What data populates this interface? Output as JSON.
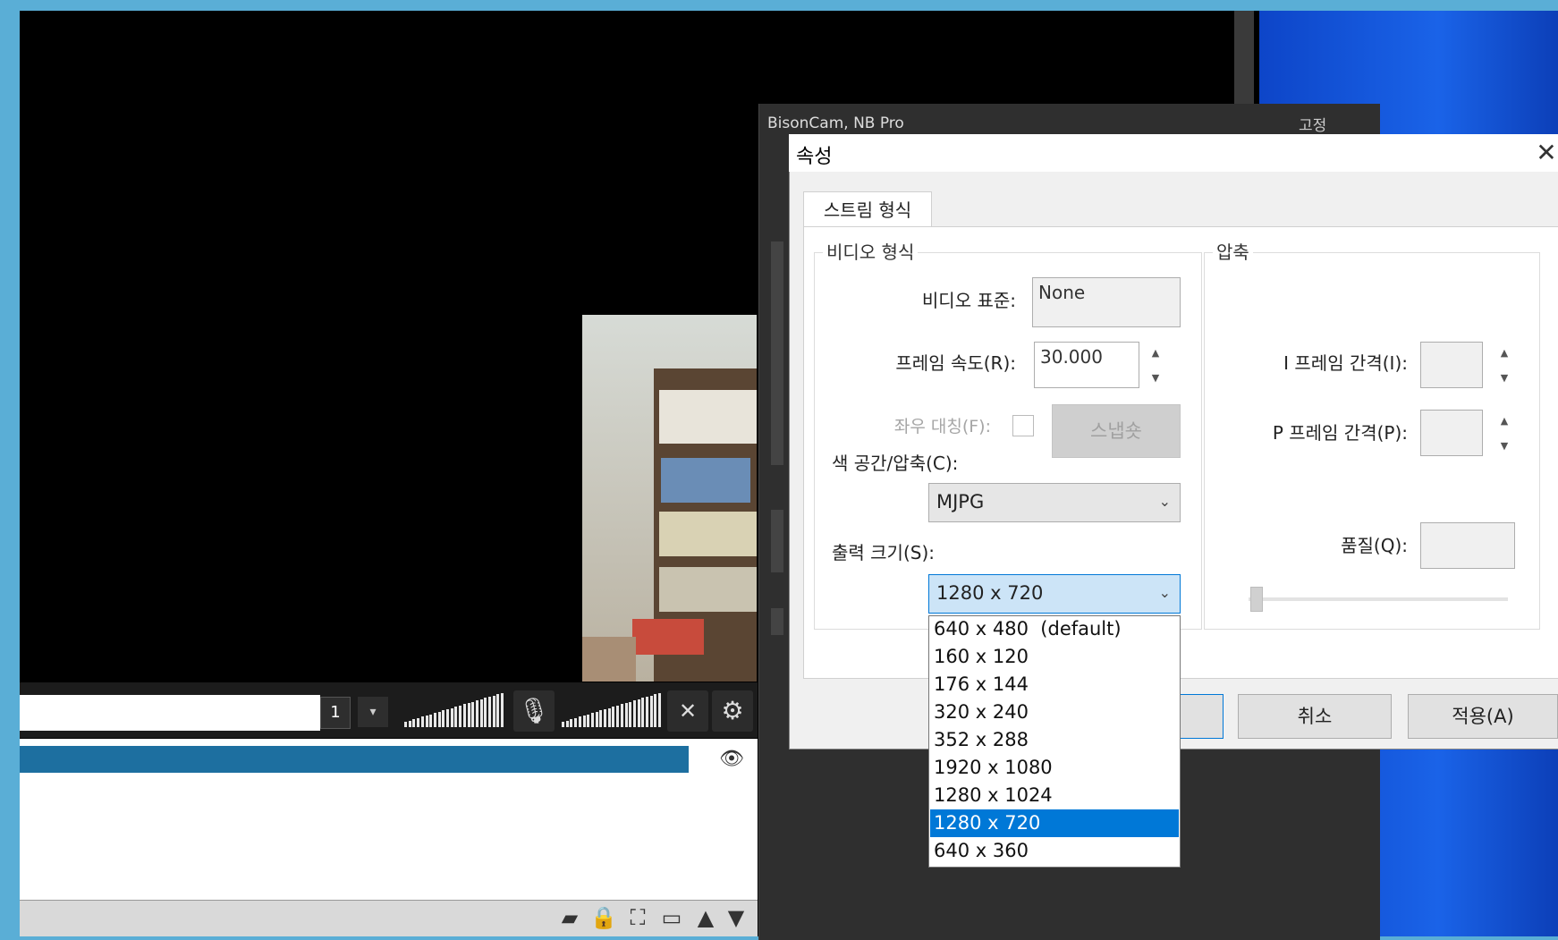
{
  "camera_window": {
    "title": "BisonCam, NB Pro",
    "controls": "고정"
  },
  "dialog": {
    "title": "속성",
    "close": "✕",
    "tab": "스트림 형식",
    "video_format_group": "비디오 형식",
    "compression_group": "압축",
    "video_standard_label": "비디오 표준:",
    "video_standard_value": "None",
    "frame_rate_label": "프레임 속도(R):",
    "frame_rate_value": "30.000",
    "flip_label": "좌우 대칭(F):",
    "snapshot_button": "스냅숏",
    "color_space_label": "색 공간/압축(C):",
    "color_space_value": "MJPG",
    "output_size_label": "출력 크기(S):",
    "output_size_value": "1280 x 720",
    "iframe_label": "I 프레임 간격(I):",
    "pframe_label": "P 프레임 간격(P):",
    "quality_label": "품질(Q):",
    "cancel_button": "취소",
    "apply_button": "적용(A)",
    "output_size_options": [
      "640 x 480  (default)",
      "160 x 120",
      "176 x 144",
      "320 x 240",
      "352 x 288",
      "1920 x 1080",
      "1280 x 1024",
      "1280 x 720",
      "640 x 360"
    ],
    "selected_option": "1280 x 720"
  },
  "toolbar": {
    "scene_number": "1",
    "dropdown_icon": "caret-down-icon",
    "mic_icon": "microphone-icon",
    "speaker_icon": "speaker-muted-icon",
    "settings_icon": "gear-icon"
  },
  "list": {
    "eye_icon": "eye-icon",
    "footer_icons": [
      "folder-icon",
      "lock-icon",
      "fit-icon",
      "layout-icon",
      "up-arrow-icon",
      "down-arrow-icon"
    ]
  },
  "colors": {
    "selected_blue": "#0078d7",
    "list_selection": "#1d6fa0",
    "desktop_blue": "#1a63e8"
  }
}
